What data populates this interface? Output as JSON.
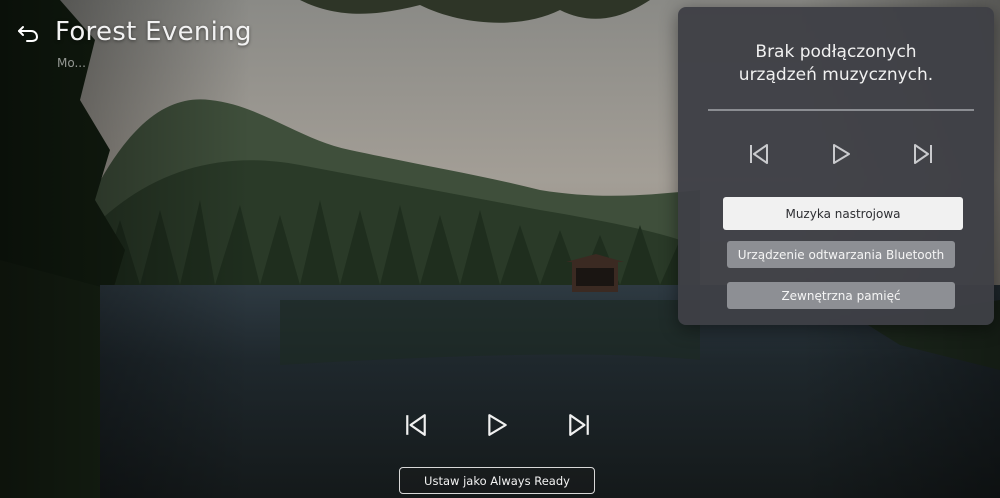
{
  "header": {
    "title": "Forest Evening",
    "subtitle": "Mo..."
  },
  "panel": {
    "message_line1": "Brak podłączonych",
    "message_line2": "urządzeń muzycznych.",
    "buttons": [
      {
        "label": "Muzyka nastrojowa",
        "selected": true
      },
      {
        "label": "Urządzenie odtwarzania Bluetooth",
        "selected": false
      },
      {
        "label": "Zewnętrzna pamięć",
        "selected": false
      }
    ]
  },
  "footer": {
    "always_ready_label": "Ustaw jako Always Ready"
  },
  "icons": {
    "back": "back-arrow-icon",
    "previous": "skip-previous-icon",
    "play": "play-icon",
    "next": "skip-next-icon"
  },
  "colors": {
    "panel_bg": "#3e4046",
    "selected_button": "#f1f1f1",
    "normal_button": "#8d8f94"
  }
}
